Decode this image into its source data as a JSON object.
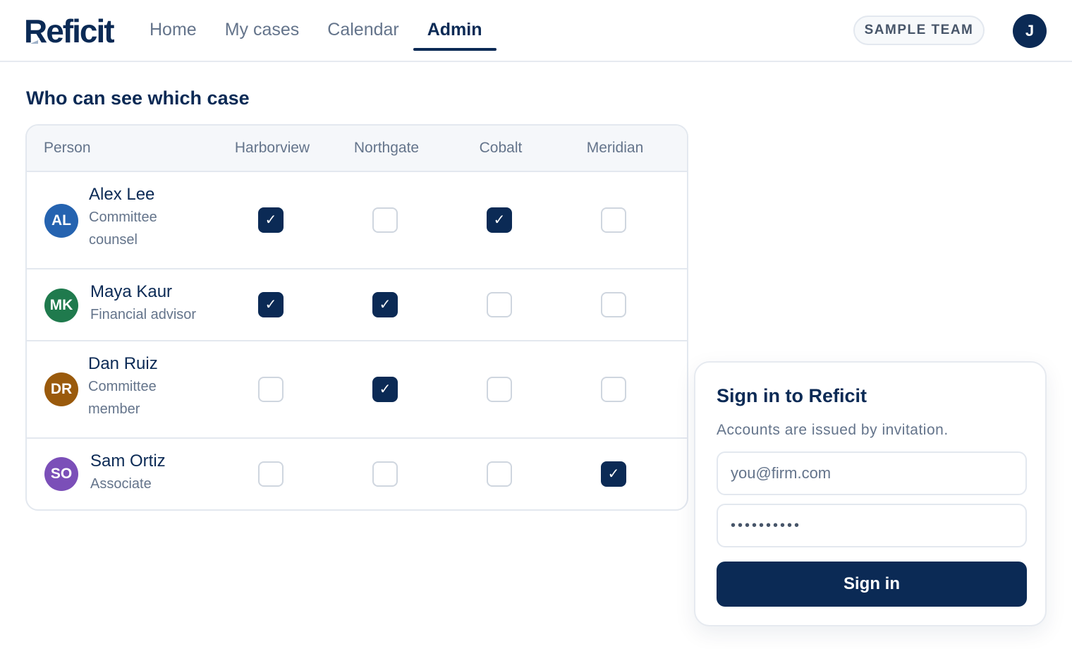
{
  "app": {
    "brand": "Reficit"
  },
  "nav": {
    "tabs": [
      {
        "label": "Home",
        "active": false
      },
      {
        "label": "My cases",
        "active": false
      },
      {
        "label": "Calendar",
        "active": false
      },
      {
        "label": "Admin",
        "active": true
      }
    ]
  },
  "header": {
    "team_label": "SAMPLE TEAM",
    "user_initial": "J"
  },
  "access": {
    "title": "Who can see which case",
    "person_header": "Person",
    "cases": [
      "Harborview",
      "Northgate",
      "Cobalt",
      "Meridian"
    ],
    "people": [
      {
        "initials": "AL",
        "name": "Alex Lee",
        "role": "Committee counsel",
        "avatar_color": "#2563b0",
        "access": [
          true,
          false,
          true,
          false
        ]
      },
      {
        "initials": "MK",
        "name": "Maya Kaur",
        "role": "Financial advisor",
        "avatar_color": "#1f7a4d",
        "access": [
          true,
          true,
          false,
          false
        ]
      },
      {
        "initials": "DR",
        "name": "Dan Ruiz",
        "role": "Committee member",
        "avatar_color": "#9a5a0c",
        "access": [
          false,
          true,
          false,
          false
        ]
      },
      {
        "initials": "SO",
        "name": "Sam Ortiz",
        "role": "Associate",
        "avatar_color": "#7b4fb8",
        "access": [
          false,
          false,
          false,
          true
        ]
      }
    ]
  },
  "signin": {
    "title": "Sign in to Reficit",
    "subtitle": "Accounts are issued by invitation.",
    "email_placeholder": "you@firm.com",
    "password_value": "••••••••••",
    "button_label": "Sign in"
  },
  "colors": {
    "brand_navy": "#0b2a55",
    "muted_text": "#64748b",
    "border": "#e3e8ef"
  },
  "icons": {
    "checkmark": "check-icon"
  }
}
